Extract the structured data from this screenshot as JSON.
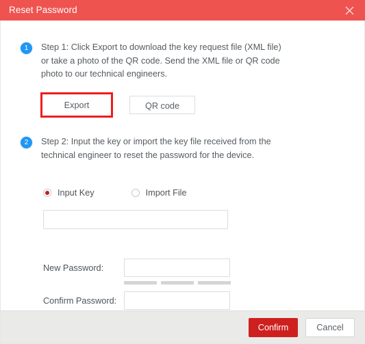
{
  "dialog": {
    "title": "Reset Password",
    "close_icon": "close-icon",
    "header_color": "#ee5350"
  },
  "steps": [
    {
      "badge": "1",
      "text": "Step 1: Click Export to download the key request file (XML file) or take a photo of the QR code. Send the XML file or QR code photo to our technical engineers."
    },
    {
      "badge": "2",
      "text": "Step 2: Input the key or import the key file received from the technical engineer to reset the password for the device."
    }
  ],
  "step1_buttons": {
    "export_label": "Export",
    "qr_label": "QR code",
    "highlight_color": "#ee1c1c"
  },
  "key_source": {
    "options": [
      {
        "label": "Input Key",
        "selected": true
      },
      {
        "label": "Import File",
        "selected": false
      }
    ],
    "selected_color": "#c0201b"
  },
  "fields": {
    "key_value": "",
    "key_placeholder": "",
    "new_password_label": "New Password:",
    "new_password_value": "",
    "confirm_password_label": "Confirm Password:",
    "confirm_password_value": ""
  },
  "strength_meter": {
    "segments": 3,
    "filled": 0,
    "segment_color": "#d4d6d4"
  },
  "footer": {
    "confirm_label": "Confirm",
    "cancel_label": "Cancel",
    "confirm_color": "#cf2020",
    "background": "#eaebe9"
  }
}
